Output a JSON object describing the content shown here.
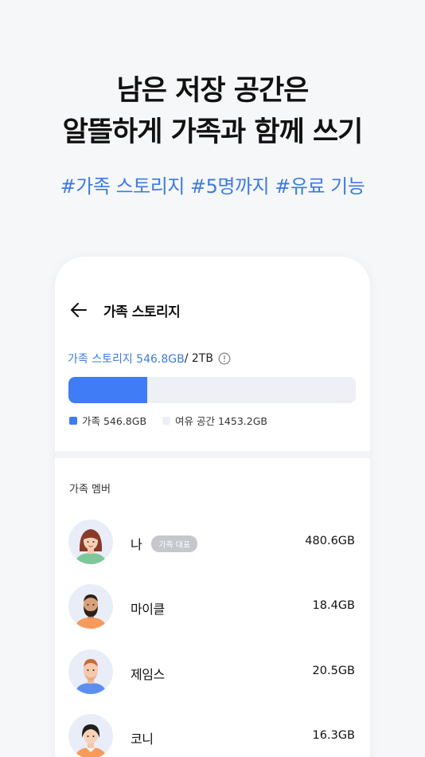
{
  "promo": {
    "headline_line1": "남은 저장 공간은",
    "headline_line2": "알뜰하게 가족과 함께 쓰기",
    "tags": "#가족 스토리지 #5명까지 #유료 기능"
  },
  "appbar": {
    "back_icon": "arrow-left-icon",
    "title": "가족 스토리지"
  },
  "storage": {
    "usage_label": "가족 스토리지 546.8GB",
    "total_label": " / 2TB",
    "info_icon": "info-icon",
    "used_fraction": 0.273,
    "bar_color": "#3f7cf5",
    "track_color": "#eef0f6",
    "legend": [
      {
        "label": "가족 546.8GB",
        "color": "#3f7cf5"
      },
      {
        "label": "여유 공간 1453.2GB",
        "color": "#eef0f6"
      }
    ]
  },
  "members_section": {
    "label": "가족 멤버",
    "members": [
      {
        "name": "나",
        "badge": "가족 대표",
        "size": "480.6GB",
        "avatar": "woman-avatar-icon"
      },
      {
        "name": "마이클",
        "badge": "",
        "size": "18.4GB",
        "avatar": "bearded-man-avatar-icon"
      },
      {
        "name": "제임스",
        "badge": "",
        "size": "20.5GB",
        "avatar": "man-avatar-icon"
      },
      {
        "name": "코니",
        "badge": "",
        "size": "16.3GB",
        "avatar": "girl-avatar-icon"
      }
    ]
  },
  "colors": {
    "accent": "#3d7be0",
    "background": "#f6f7f9"
  }
}
